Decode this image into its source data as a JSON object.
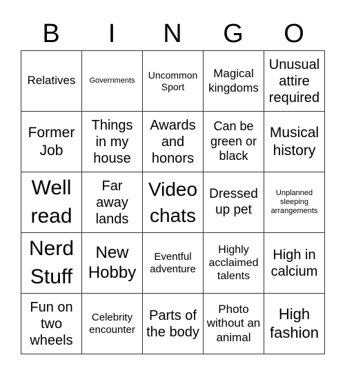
{
  "header": [
    "B",
    "I",
    "N",
    "G",
    "O"
  ],
  "cells": [
    {
      "text": "Relatives",
      "size": 17
    },
    {
      "text": "Governments",
      "size": 11
    },
    {
      "text": "Uncommon Sport",
      "size": 14
    },
    {
      "text": "Magical kingdoms",
      "size": 17
    },
    {
      "text": "Unusual attire required",
      "size": 20
    },
    {
      "text": "Former Job",
      "size": 21
    },
    {
      "text": "Things in my house",
      "size": 20
    },
    {
      "text": "Awards and honors",
      "size": 20
    },
    {
      "text": "Can be green or black",
      "size": 18
    },
    {
      "text": "Musical history",
      "size": 21
    },
    {
      "text": "Well read",
      "size": 30
    },
    {
      "text": "Far away lands",
      "size": 20
    },
    {
      "text": "Video chats",
      "size": 28
    },
    {
      "text": "Dressed up pet",
      "size": 19
    },
    {
      "text": "Unplanned sleeping arrangements",
      "size": 11
    },
    {
      "text": "Nerd Stuff",
      "size": 30
    },
    {
      "text": "New Hobby",
      "size": 24
    },
    {
      "text": "Eventful adventure",
      "size": 15
    },
    {
      "text": "Highly acclaimed talents",
      "size": 16
    },
    {
      "text": "High in calcium",
      "size": 20
    },
    {
      "text": "Fun on two wheels",
      "size": 20
    },
    {
      "text": "Celebrity encounter",
      "size": 15
    },
    {
      "text": "Parts of the body",
      "size": 20
    },
    {
      "text": "Photo without an animal",
      "size": 17
    },
    {
      "text": "High fashion",
      "size": 22
    }
  ]
}
